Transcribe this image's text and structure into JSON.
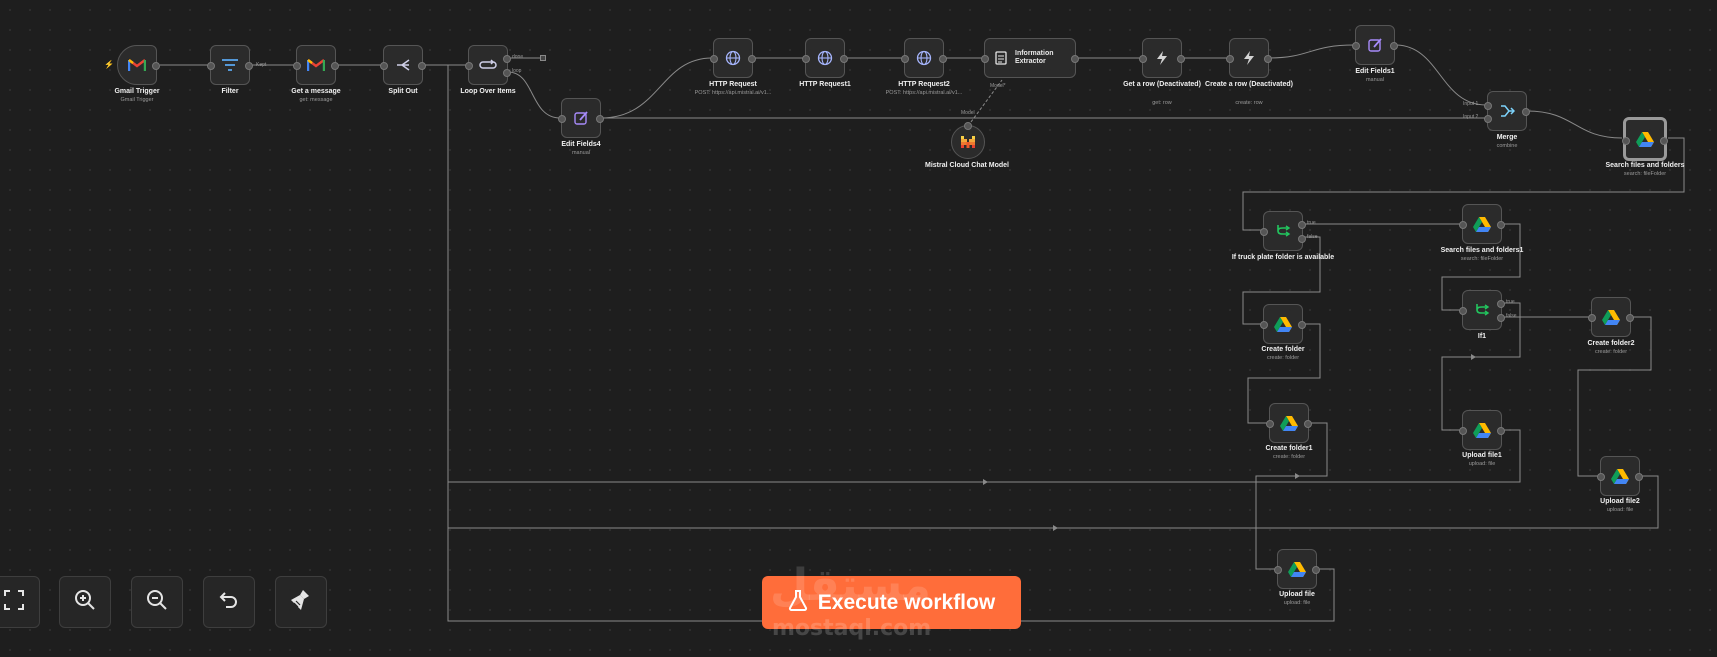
{
  "colors": {
    "background": "#1e1e1e",
    "node_bg": "#2b2b2b",
    "accent": "#ff6d3a",
    "edge": "#8a8a8a"
  },
  "nodes": {
    "gmail_trigger": {
      "name": "Gmail Trigger",
      "sub": "Gmail Trigger",
      "icon": "gmail-icon"
    },
    "filter": {
      "name": "Filter",
      "icon": "filter-icon",
      "branch": "Kept"
    },
    "get_message": {
      "name": "Get a message",
      "sub": "get: message",
      "icon": "gmail-icon"
    },
    "split_out": {
      "name": "Split Out",
      "icon": "split-out-icon"
    },
    "loop_over_items": {
      "name": "Loop Over Items",
      "icon": "loop-icon",
      "branch_done": "done",
      "branch_loop": "loop"
    },
    "edit_fields4": {
      "name": "Edit Fields4",
      "sub": "manual",
      "icon": "pencil-icon"
    },
    "http_request": {
      "name": "HTTP Request",
      "sub": "POST: https://api.mistral.ai/v1...",
      "icon": "globe-icon"
    },
    "http_request1": {
      "name": "HTTP Request1",
      "icon": "globe-icon"
    },
    "http_request2": {
      "name": "HTTP Request2",
      "sub": "POST: https://api.mistral.ai/v1...",
      "icon": "globe-icon"
    },
    "information_extractor": {
      "name": "Information Extractor",
      "icon": "document-icon",
      "port_label": "Model*"
    },
    "mistral_model": {
      "name": "Mistral Cloud Chat Model",
      "icon": "mistral-icon",
      "port_label": "Model"
    },
    "get_row": {
      "name": "Get a row (Deactivated)",
      "sub": "get: row",
      "icon": "bolt-icon"
    },
    "create_row": {
      "name": "Create a row (Deactivated)",
      "sub": "create: row",
      "icon": "bolt-icon"
    },
    "edit_fields1": {
      "name": "Edit Fields1",
      "sub": "manual",
      "icon": "pencil-icon"
    },
    "merge": {
      "name": "Merge",
      "sub": "combine",
      "icon": "merge-icon",
      "input1": "Input 1",
      "input2": "Input 2"
    },
    "search_files": {
      "name": "Search files and folders",
      "sub": "search: fileFolder",
      "icon": "google-drive-icon"
    },
    "if_truck": {
      "name": "If truck plate folder is available",
      "icon": "if-icon",
      "true_label": "true",
      "false_label": "false"
    },
    "search_files1": {
      "name": "Search files and folders1",
      "sub": "search: fileFolder",
      "icon": "google-drive-icon"
    },
    "create_folder": {
      "name": "Create folder",
      "sub": "create: folder",
      "icon": "google-drive-icon"
    },
    "if1": {
      "name": "If1",
      "icon": "if-icon",
      "true_label": "true",
      "false_label": "false"
    },
    "create_folder2": {
      "name": "Create folder2",
      "sub": "create: folder",
      "icon": "google-drive-icon"
    },
    "create_folder1": {
      "name": "Create folder1",
      "sub": "create: folder",
      "icon": "google-drive-icon"
    },
    "upload_file1": {
      "name": "Upload file1",
      "sub": "upload: file",
      "icon": "google-drive-icon"
    },
    "upload_file2": {
      "name": "Upload file2",
      "sub": "upload: file",
      "icon": "google-drive-icon"
    },
    "upload_file": {
      "name": "Upload file",
      "sub": "upload: file",
      "icon": "google-drive-icon"
    }
  },
  "controls": {
    "fit_view": "fit-view-icon",
    "zoom_in": "zoom-in-icon",
    "zoom_out": "zoom-out-icon",
    "undo": "undo-icon",
    "tidy_up": "broom-icon"
  },
  "execute_button": {
    "label": "Execute workflow",
    "icon": "flask-icon"
  },
  "watermark": {
    "arabic": "مستقل",
    "latin": "mostaql.com"
  }
}
